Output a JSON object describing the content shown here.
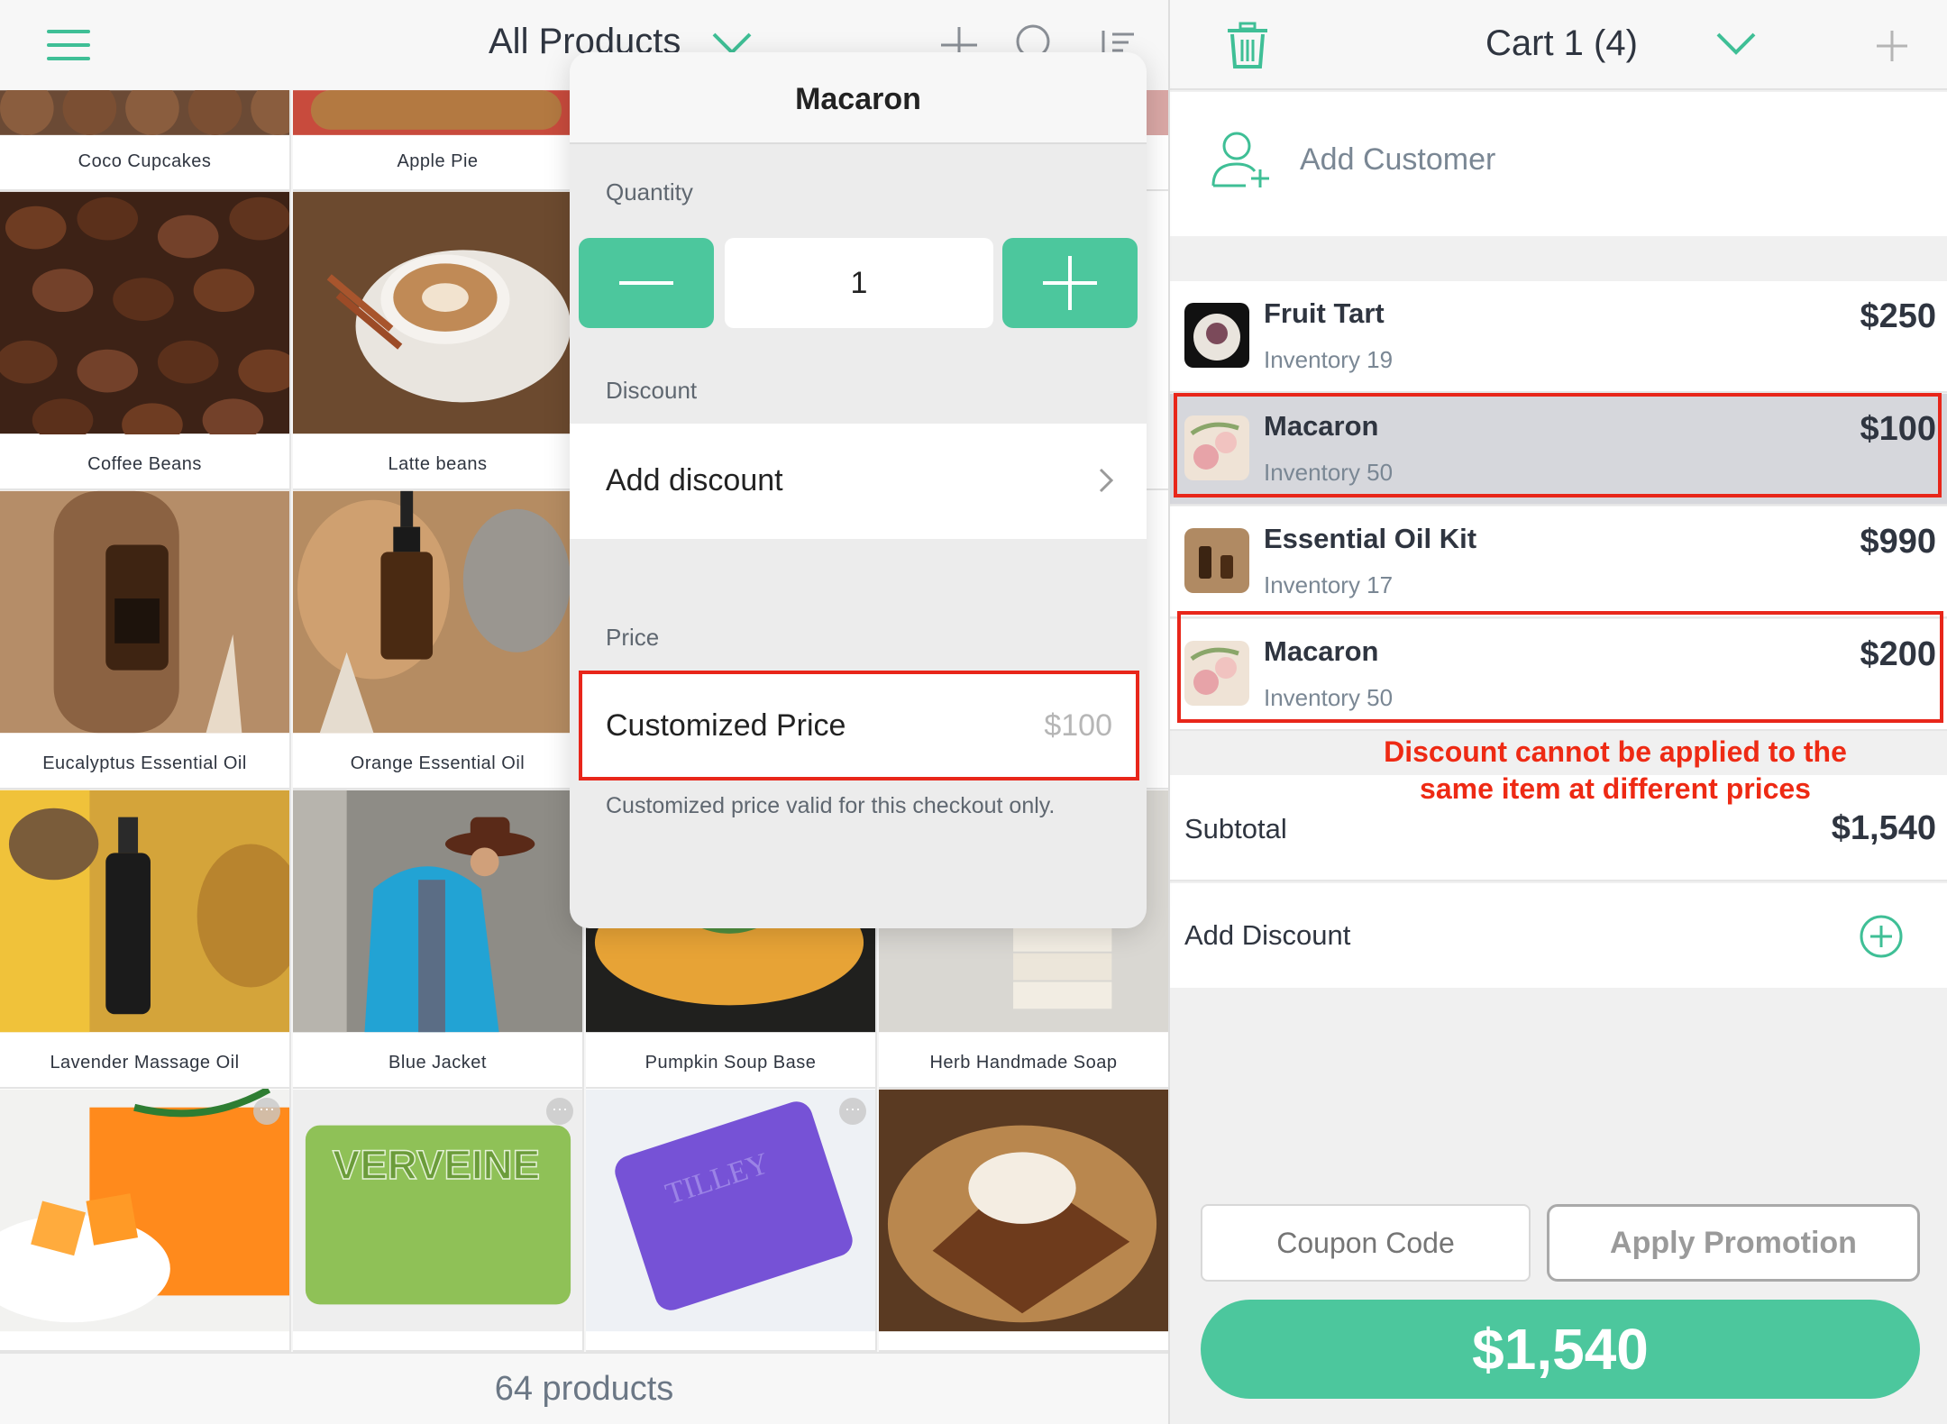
{
  "left_header": {
    "title": "All Products",
    "icons": [
      "menu-icon",
      "chevron-down-icon",
      "plus-icon",
      "search-icon",
      "sort-icon"
    ]
  },
  "products": [
    {
      "name": "Coco Cupcakes"
    },
    {
      "name": "Apple Pie"
    },
    {
      "name": "Coffee Beans"
    },
    {
      "name": "Latte beans"
    },
    {
      "name": "Eucalyptus Essential Oil"
    },
    {
      "name": "Orange Essential Oil"
    },
    {
      "name": "Lavender Massage Oil"
    },
    {
      "name": "Blue Jacket"
    },
    {
      "name": "Pumpkin Soup Base"
    },
    {
      "name": "Herb Handmade Soap"
    }
  ],
  "soap_text": {
    "verveine": "VERVEINE",
    "tilley": "TILLEY"
  },
  "footer": {
    "count_text": "64 products"
  },
  "popover": {
    "title": "Macaron",
    "quantity_label": "Quantity",
    "quantity_value": "1",
    "discount_label": "Discount",
    "add_discount_label": "Add discount",
    "price_label": "Price",
    "customized_price_label": "Customized Price",
    "customized_price_placeholder": "$100",
    "customized_price_note": "Customized price valid for this checkout only."
  },
  "cart": {
    "title": "Cart 1 (4)",
    "add_customer_label": "Add Customer",
    "items": [
      {
        "name": "Fruit Tart",
        "inventory": "Inventory 19",
        "price": "$250",
        "selected": false,
        "highlighted": false
      },
      {
        "name": "Macaron",
        "inventory": "Inventory 50",
        "price": "$100",
        "selected": true,
        "highlighted": true
      },
      {
        "name": "Essential Oil Kit",
        "inventory": "Inventory 17",
        "price": "$990",
        "selected": false,
        "highlighted": false
      },
      {
        "name": "Macaron",
        "inventory": "Inventory 50",
        "price": "$200",
        "selected": false,
        "highlighted": true
      }
    ],
    "annotation": "Discount cannot be applied to the same item at different prices",
    "subtotal_label": "Subtotal",
    "subtotal_value": "$1,540",
    "add_discount_label": "Add Discount",
    "coupon_placeholder": "Coupon Code",
    "apply_promotion_label": "Apply Promotion",
    "total_button_label": "$1,540"
  },
  "colors": {
    "accent": "#4cc79d",
    "annotation_red": "#e8261a",
    "text_primary": "#2f3540",
    "text_secondary": "#7a8794"
  }
}
